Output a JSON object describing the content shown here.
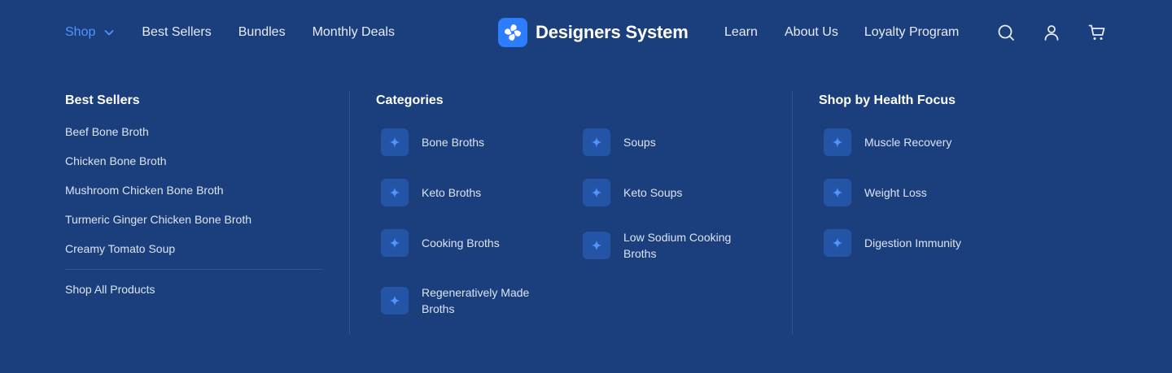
{
  "nav": {
    "left": [
      {
        "label": "Shop",
        "active": true
      },
      {
        "label": "Best Sellers"
      },
      {
        "label": "Bundles"
      },
      {
        "label": "Monthly Deals"
      }
    ],
    "brand": "Designers System",
    "right": [
      {
        "label": "Learn"
      },
      {
        "label": "About Us"
      },
      {
        "label": "Loyalty Program"
      }
    ],
    "icons": [
      "search-icon",
      "user-icon",
      "cart-icon"
    ]
  },
  "menu": {
    "best_sellers": {
      "title": "Best Sellers",
      "items": [
        "Beef Bone Broth",
        "Chicken Bone Broth",
        "Mushroom Chicken Bone Broth",
        "Turmeric Ginger Chicken Bone Broth",
        "Creamy Tomato Soup"
      ],
      "shop_all": "Shop All Products"
    },
    "categories": {
      "title": "Categories",
      "items": [
        "Bone Broths",
        "Soups",
        "Keto Broths",
        "Keto Soups",
        "Cooking Broths",
        "Low Sodium Cooking Broths",
        "Regeneratively Made Broths"
      ]
    },
    "health": {
      "title": "Shop by Health Focus",
      "items": [
        "Muscle Recovery",
        "Weight Loss",
        "Digestion Immunity"
      ]
    }
  },
  "colors": {
    "background": "#1b3f7d",
    "accent": "#4f95ff",
    "badge": "#2454a6",
    "logo": "#2c7dff"
  }
}
